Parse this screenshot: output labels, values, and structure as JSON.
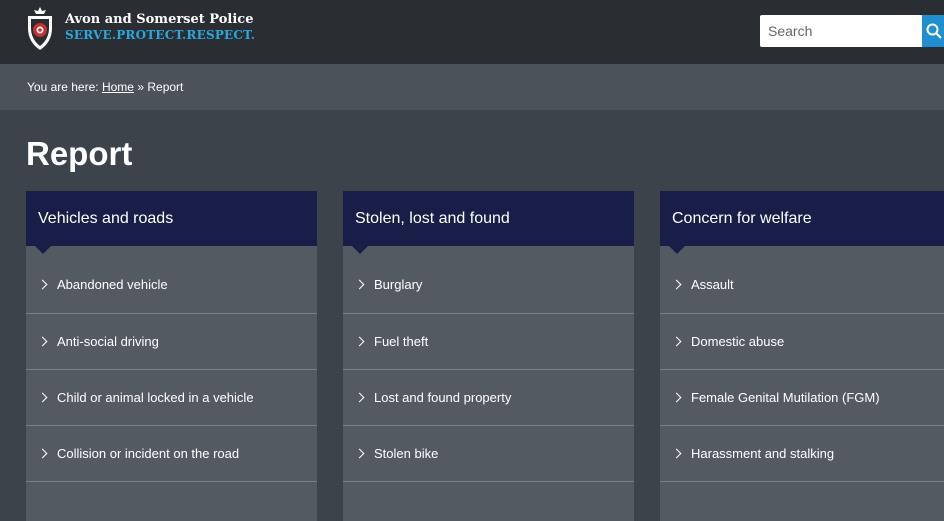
{
  "header": {
    "org_name": "Avon and Somerset Police",
    "motto": "SERVE.PROTECT.RESPECT.",
    "logo_icon": "police-crest-icon",
    "search_placeholder": "Search",
    "search_icon": "search-icon"
  },
  "breadcrumb": {
    "prefix": "You are here:",
    "home": "Home",
    "separator": "»",
    "current": "Report"
  },
  "page": {
    "title": "Report"
  },
  "cards": [
    {
      "title": "Vehicles and roads",
      "items": [
        "Abandoned vehicle",
        "Anti-social driving",
        "Child or animal locked in a vehicle",
        "Collision or incident on the road"
      ]
    },
    {
      "title": "Stolen, lost and found",
      "items": [
        "Burglary",
        "Fuel theft",
        "Lost and found property",
        "Stolen bike"
      ]
    },
    {
      "title": "Concern for welfare",
      "items": [
        "Assault",
        "Domestic abuse",
        "Female Genital Mutilation (FGM)",
        "Harassment and stalking"
      ]
    }
  ],
  "colors": {
    "header_bg": "#2a2d31",
    "breadcrumb_bg": "#4c525a",
    "page_bg": "#3d434b",
    "card_header_bg": "#191e49",
    "card_body_bg": "#545a62",
    "motto_color": "#29a8e0",
    "search_button_bg": "#1f8fd0"
  }
}
